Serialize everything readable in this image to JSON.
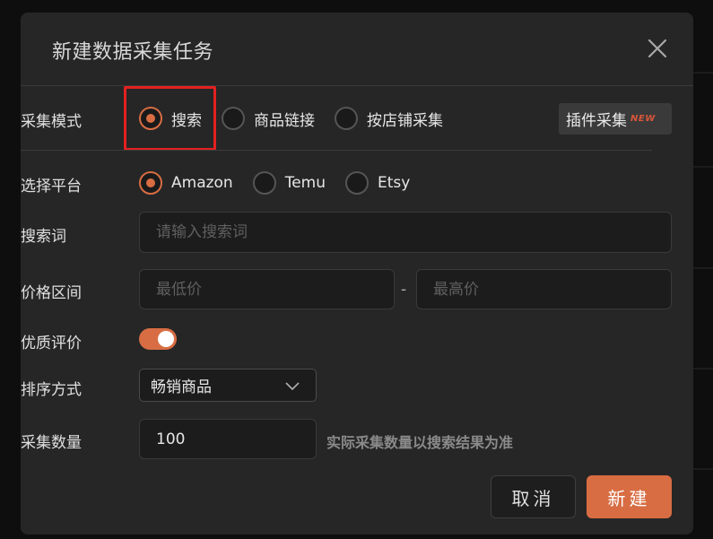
{
  "dialog": {
    "title": "新建数据采集任务"
  },
  "mode": {
    "label": "采集模式",
    "options": [
      "搜索",
      "商品链接",
      "按店铺采集"
    ],
    "selected": "搜索",
    "plugin_label": "插件采集",
    "plugin_badge": "NEW"
  },
  "platform": {
    "label": "选择平台",
    "options": [
      "Amazon",
      "Temu",
      "Etsy"
    ],
    "selected": "Amazon"
  },
  "keyword": {
    "label": "搜索词",
    "placeholder": "请输入搜索词",
    "value": ""
  },
  "price": {
    "label": "价格区间",
    "min_placeholder": "最低价",
    "max_placeholder": "最高价",
    "separator": "-"
  },
  "quality": {
    "label": "优质评价",
    "enabled": true
  },
  "sort": {
    "label": "排序方式",
    "value": "畅销商品"
  },
  "count": {
    "label": "采集数量",
    "value": "100",
    "hint": "实际采集数量以搜索结果为准"
  },
  "actions": {
    "cancel": "取消",
    "create": "新建"
  },
  "colors": {
    "accent": "#d86d43",
    "highlight": "#e32020",
    "dialog_bg": "#262626"
  }
}
